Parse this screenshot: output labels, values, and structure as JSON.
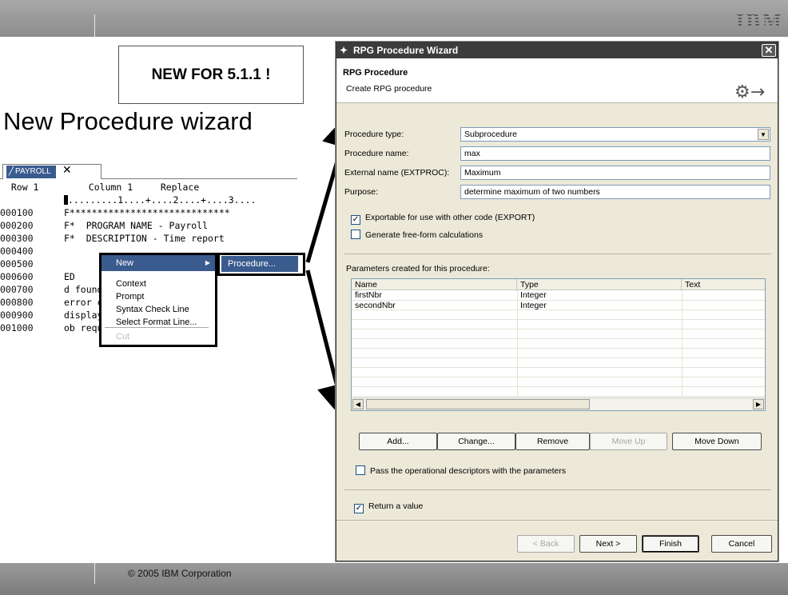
{
  "slide": {
    "logo": "IBM",
    "callout": "NEW FOR 5.1.1 !",
    "heading": "New Procedure wizard",
    "copyright": "© 2005 IBM Corporation"
  },
  "editor": {
    "tab_label": "PAYROLL",
    "tab_close": "✕",
    "status_row": "Row 1",
    "status_column": "Column 1",
    "status_mode": "Replace",
    "ruler": ".........1....+....2....+....3....",
    "lines": [
      {
        "seq": "000100",
        "text": "F*****************************"
      },
      {
        "seq": "000200",
        "text": "F*  PROGRAM NAME - Payroll"
      },
      {
        "seq": "000300",
        "text": "F*  DESCRIPTION - Time report"
      },
      {
        "seq": "000400",
        "text": ""
      },
      {
        "seq": "000500",
        "text": ""
      },
      {
        "seq": "000600",
        "text": "ED"
      },
      {
        "seq": "000700",
        "text": "d found on C"
      },
      {
        "seq": "000800",
        "text": "error condit"
      },
      {
        "seq": "000900",
        "text": "display on c"
      },
      {
        "seq": "001000",
        "text": "ob requested"
      }
    ],
    "context_menu": {
      "new": "New",
      "items": [
        "Context",
        "Prompt",
        "Syntax Check Line",
        "Select Format Line..."
      ],
      "faded": "Cut"
    },
    "submenu": "Procedure..."
  },
  "wizard": {
    "title": "RPG Procedure Wizard",
    "banner_title": "RPG Procedure",
    "banner_subtitle": "Create RPG procedure",
    "fields": {
      "procedure_type_label": "Procedure type:",
      "procedure_type_value": "Subprocedure",
      "procedure_name_label": "Procedure name:",
      "procedure_name_value": "max",
      "external_name_label": "External name (EXTPROC):",
      "external_name_value": "Maximum",
      "purpose_label": "Purpose:",
      "purpose_value": "determine maximum of two numbers"
    },
    "checks": {
      "export_label": "Exportable for use with other code (EXPORT)",
      "export_checked": true,
      "freeform_label": "Generate free-form calculations",
      "freeform_checked": false,
      "pass_label": "Pass the operational descriptors with the parameters",
      "pass_checked": false,
      "return_label": "Return a value",
      "return_checked": true
    },
    "params_label": "Parameters created for this procedure:",
    "columns": [
      "Name",
      "Type",
      "Text"
    ],
    "rows": [
      {
        "name": "firstNbr",
        "type": "Integer",
        "text": ""
      },
      {
        "name": "secondNbr",
        "type": "Integer",
        "text": ""
      }
    ],
    "buttons": {
      "add": "Add...",
      "change": "Change...",
      "remove": "Remove",
      "move_up": "Move Up",
      "move_down": "Move Down",
      "back": "< Back",
      "next": "Next >",
      "finish": "Finish",
      "cancel": "Cancel"
    }
  }
}
